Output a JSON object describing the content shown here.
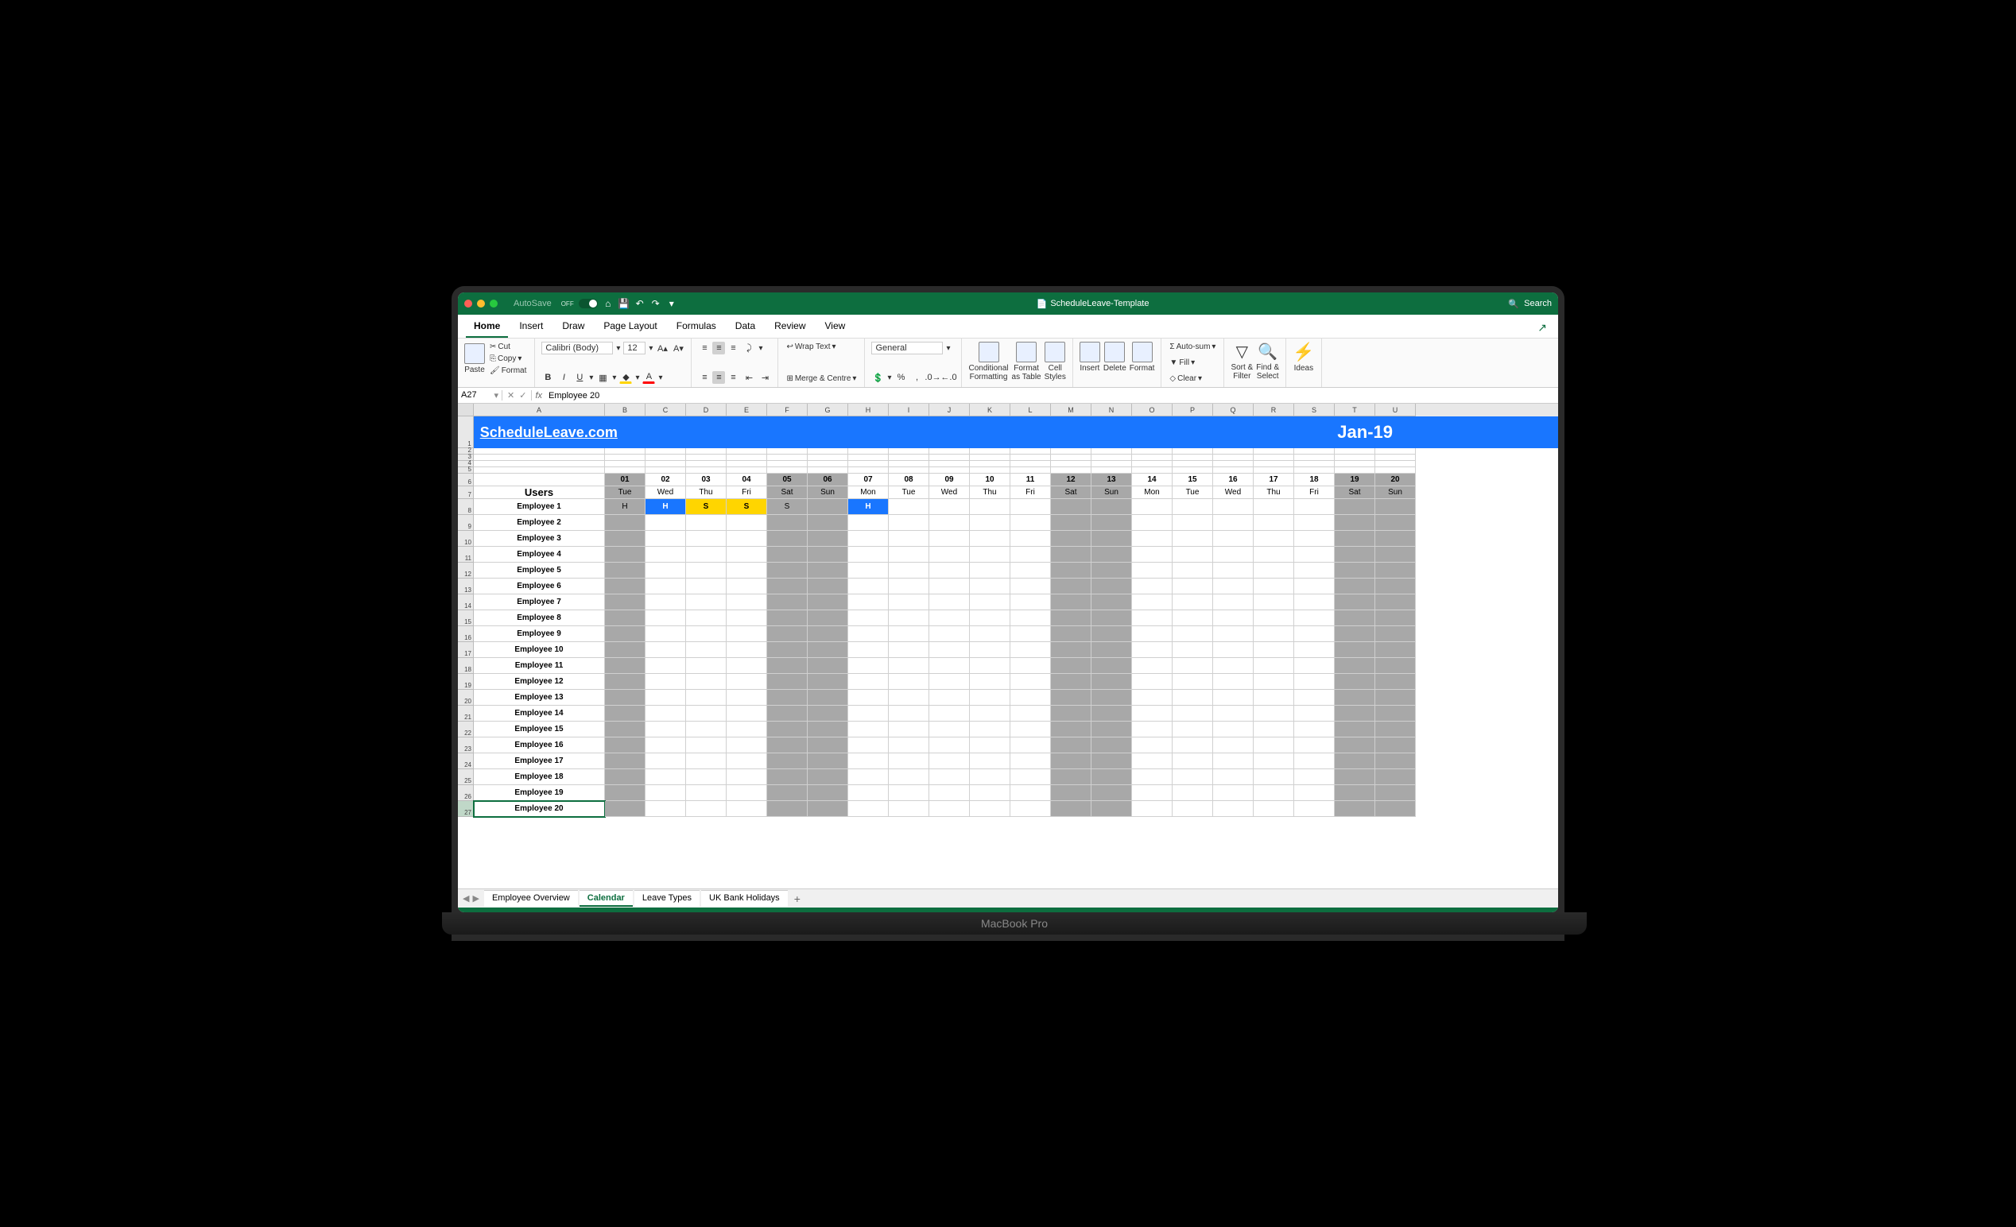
{
  "titlebar": {
    "autosave_label": "AutoSave",
    "autosave_state": "OFF",
    "document_title": "ScheduleLeave-Template",
    "search_placeholder": "Search"
  },
  "tabs": [
    "Home",
    "Insert",
    "Draw",
    "Page Layout",
    "Formulas",
    "Data",
    "Review",
    "View"
  ],
  "active_tab": "Home",
  "ribbon": {
    "paste": "Paste",
    "cut": "Cut",
    "copy": "Copy",
    "format_painter": "Format",
    "font_name": "Calibri (Body)",
    "font_size": "12",
    "wrap_text": "Wrap Text",
    "merge_centre": "Merge & Centre",
    "number_format": "General",
    "conditional_formatting": "Conditional\nFormatting",
    "format_as_table": "Format\nas Table",
    "cell_styles": "Cell\nStyles",
    "insert": "Insert",
    "delete": "Delete",
    "format": "Format",
    "autosum": "Auto-sum",
    "fill": "Fill",
    "clear": "Clear",
    "sort_filter": "Sort &\nFilter",
    "find_select": "Find &\nSelect",
    "ideas": "Ideas"
  },
  "formula_bar": {
    "name_box": "A27",
    "formula": "Employee 20"
  },
  "columns": [
    "A",
    "B",
    "C",
    "D",
    "E",
    "F",
    "G",
    "H",
    "I",
    "J",
    "K",
    "L",
    "M",
    "N",
    "O",
    "P",
    "Q",
    "R",
    "S",
    "T",
    "U"
  ],
  "banner": {
    "title": "ScheduleLeave.com",
    "month": "Jan-19"
  },
  "day_numbers": [
    "01",
    "02",
    "03",
    "04",
    "05",
    "06",
    "07",
    "08",
    "09",
    "10",
    "11",
    "12",
    "13",
    "14",
    "15",
    "16",
    "17",
    "18",
    "19",
    "20"
  ],
  "day_names": [
    "Tue",
    "Wed",
    "Thu",
    "Fri",
    "Sat",
    "Sun",
    "Mon",
    "Tue",
    "Wed",
    "Thu",
    "Fri",
    "Sat",
    "Sun",
    "Mon",
    "Tue",
    "Wed",
    "Thu",
    "Fri",
    "Sat",
    "Sun"
  ],
  "weekend_cols": [
    0,
    4,
    5,
    11,
    12,
    18,
    19
  ],
  "users_label": "Users",
  "employees": [
    "Employee 1",
    "Employee 2",
    "Employee 3",
    "Employee 4",
    "Employee 5",
    "Employee 6",
    "Employee 7",
    "Employee 8",
    "Employee 9",
    "Employee 10",
    "Employee 11",
    "Employee 12",
    "Employee 13",
    "Employee 14",
    "Employee 15",
    "Employee 16",
    "Employee 17",
    "Employee 18",
    "Employee 19",
    "Employee 20"
  ],
  "leave_entries": {
    "0": {
      "0": {
        "code": "H",
        "type": "gray"
      },
      "1": {
        "code": "H",
        "type": "holiday"
      },
      "2": {
        "code": "S",
        "type": "sick"
      },
      "3": {
        "code": "S",
        "type": "sick"
      },
      "4": {
        "code": "S",
        "type": "gray"
      },
      "6": {
        "code": "H",
        "type": "holiday"
      }
    }
  },
  "row_numbers_start": 1,
  "selected_row": 27,
  "sheet_tabs": [
    "Employee Overview",
    "Calendar",
    "Leave Types",
    "UK Bank Holidays"
  ],
  "active_sheet": "Calendar",
  "laptop_label": "MacBook Pro"
}
